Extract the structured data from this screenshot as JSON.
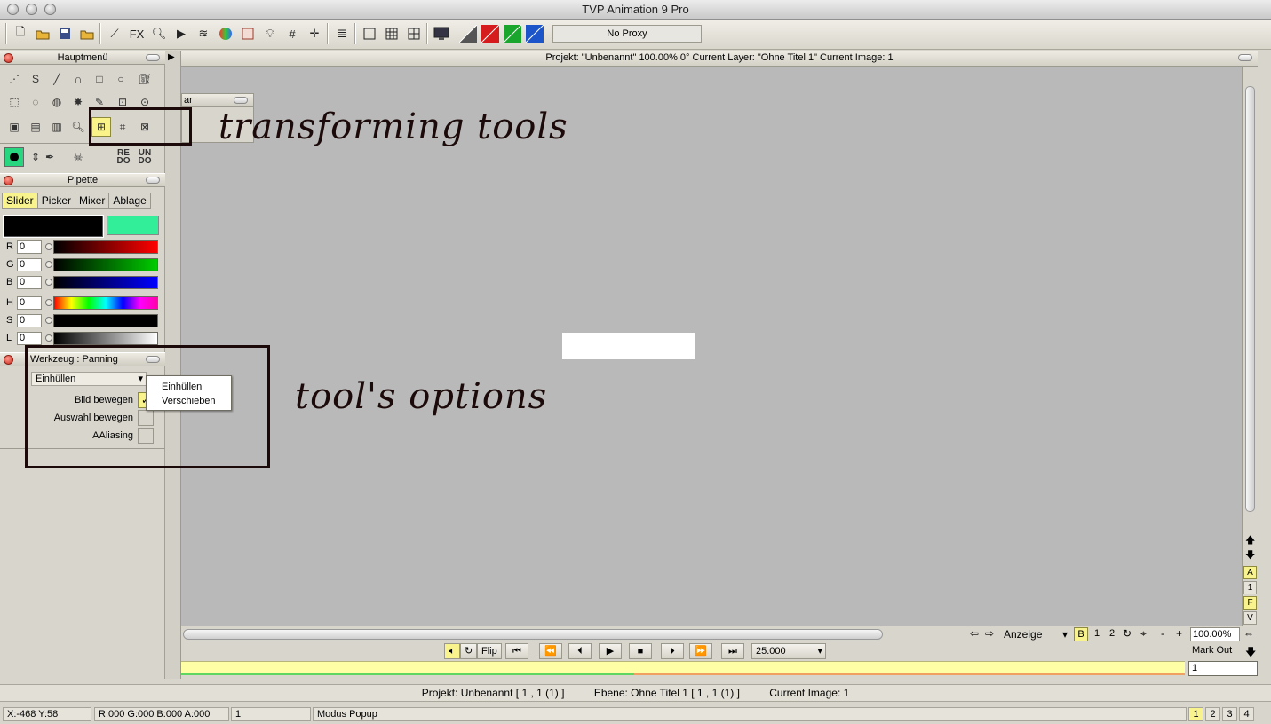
{
  "window": {
    "title": "TVP Animation 9 Pro"
  },
  "toolbar": {
    "fx_label": "FX",
    "proxy_label": "No Proxy"
  },
  "hauptmenu": {
    "title": "Hauptmenü",
    "redo_label": "RE\nDO",
    "undo_label": "UN\nDO"
  },
  "pipette": {
    "title": "Pipette",
    "tabs": [
      "Slider",
      "Picker",
      "Mixer",
      "Ablage"
    ],
    "active_tab": "Slider",
    "primary_color": "#000000",
    "secondary_color": "#33ee99",
    "sliders": [
      {
        "label": "R",
        "value": "0"
      },
      {
        "label": "G",
        "value": "0"
      },
      {
        "label": "B",
        "value": "0"
      },
      {
        "label": "H",
        "value": "0"
      },
      {
        "label": "S",
        "value": "0"
      },
      {
        "label": "L",
        "value": "0"
      }
    ]
  },
  "floating_panel": {
    "title": "ar"
  },
  "werkzeug": {
    "title": "Werkzeug : Panning",
    "mode_select": "Einhüllen",
    "mode_options": [
      "Einhüllen",
      "Verschieben"
    ],
    "bild_bewegen_label": "Bild bewegen",
    "bild_bewegen_checked": true,
    "auswahl_bewegen_label": "Auswahl bewegen",
    "auswahl_bewegen_checked": false,
    "aaliasing_label": "AAliasing",
    "aaliasing_checked": false
  },
  "canvas": {
    "header": "Projekt:  \"Unbenannt\"   100.00%   0°  Current Layer: \"Ohne Titel 1\"  Current Image: 1"
  },
  "view_controls": {
    "anzeige": "Anzeige",
    "b_label": "B",
    "one_label": "1",
    "two_label": "2",
    "minus": "-",
    "plus": "+",
    "zoom": "100.00%"
  },
  "side_buttons": [
    "A",
    "1",
    "F",
    "V"
  ],
  "transport": {
    "flip_label": "Flip",
    "fps": "25.000",
    "mark_out": "Mark Out",
    "frame_field": "1"
  },
  "status_bar": {
    "project": "Projekt: Unbenannt [ 1 , 1  (1) ]",
    "layer": "Ebene: Ohne Titel 1 [ 1 , 1  (1) ]",
    "image": "Current Image: 1"
  },
  "info_bar": {
    "coords": "X:-468  Y:58",
    "color": "R:000 G:000 B:000 A:000",
    "frame": "1",
    "mode": "Modus Popup",
    "pages": [
      "1",
      "2",
      "3",
      "4"
    ]
  },
  "annotations": {
    "transforming": "transforming tools",
    "options": "tool's options"
  }
}
